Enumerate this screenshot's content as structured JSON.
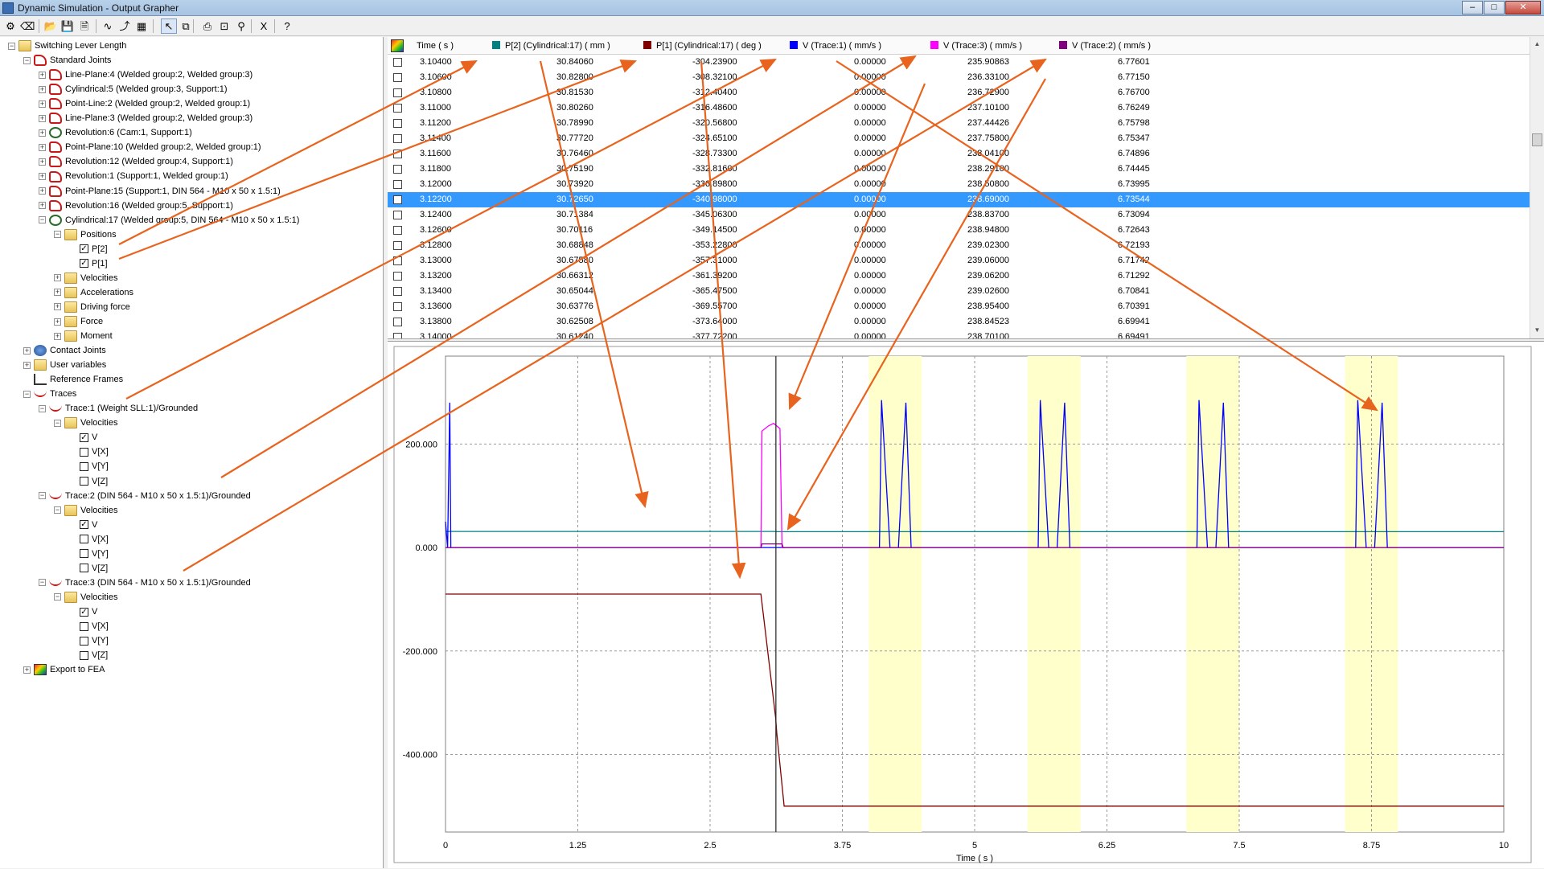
{
  "window": {
    "title": "Dynamic Simulation - Output Grapher",
    "controls": [
      "–",
      "□",
      "✕"
    ]
  },
  "toolbar": {
    "buttons": [
      {
        "icon": "simulate-icon",
        "glyph": "⚙"
      },
      {
        "icon": "eraser-icon",
        "glyph": "⌫"
      },
      {
        "icon": "open-icon",
        "glyph": "📂"
      },
      {
        "icon": "save-icon",
        "glyph": "💾"
      },
      {
        "icon": "save-as-icon",
        "glyph": "🗎"
      },
      {
        "icon": "curve-icon",
        "glyph": "∿"
      },
      {
        "icon": "add-curve-icon",
        "glyph": "⤴"
      },
      {
        "icon": "multi-curve-icon",
        "glyph": "▦"
      },
      {
        "icon": "cursor-icon",
        "glyph": "↖"
      },
      {
        "icon": "copy-icon",
        "glyph": "⧉"
      },
      {
        "icon": "print-icon",
        "glyph": "⎙"
      },
      {
        "icon": "zoom-fit-icon",
        "glyph": "⊡"
      },
      {
        "icon": "zoom-icon",
        "glyph": "⚲"
      },
      {
        "icon": "excel-icon",
        "glyph": "X"
      },
      {
        "icon": "help-icon",
        "glyph": "?"
      }
    ]
  },
  "tree": {
    "nodes": [
      {
        "label": "Switching Lever Length",
        "level": 0,
        "icon": "folder",
        "exp": "−"
      },
      {
        "label": "Standard Joints",
        "level": 1,
        "icon": "joint",
        "exp": "−"
      },
      {
        "label": "Line-Plane:4 (Welded group:2, Welded group:3)",
        "level": 2,
        "icon": "joint",
        "exp": "+"
      },
      {
        "label": "Cylindrical:5 (Welded group:3, Support:1)",
        "level": 2,
        "icon": "joint",
        "exp": "+"
      },
      {
        "label": "Point-Line:2 (Welded group:2, Welded group:1)",
        "level": 2,
        "icon": "joint",
        "exp": "+"
      },
      {
        "label": "Line-Plane:3 (Welded group:2, Welded group:3)",
        "level": 2,
        "icon": "joint",
        "exp": "+"
      },
      {
        "label": "Revolution:6 (Cam:1, Support:1)",
        "level": 2,
        "icon": "rev",
        "exp": "+"
      },
      {
        "label": "Point-Plane:10 (Welded group:2, Welded group:1)",
        "level": 2,
        "icon": "joint",
        "exp": "+"
      },
      {
        "label": "Revolution:12 (Welded group:4, Support:1)",
        "level": 2,
        "icon": "joint",
        "exp": "+"
      },
      {
        "label": "Revolution:1 (Support:1, Welded group:1)",
        "level": 2,
        "icon": "joint",
        "exp": "+"
      },
      {
        "label": "Point-Plane:15 (Support:1, DIN 564 - M10 x 50 x 1.5:1)",
        "level": 2,
        "icon": "joint",
        "exp": "+"
      },
      {
        "label": "Revolution:16 (Welded group:5, Support:1)",
        "level": 2,
        "icon": "joint",
        "exp": "+"
      },
      {
        "label": "Cylindrical:17 (Welded group:5, DIN 564 - M10 x 50 x 1.5:1)",
        "level": 2,
        "icon": "rev",
        "exp": "−"
      },
      {
        "label": "Positions",
        "level": 3,
        "icon": "folder",
        "exp": "−"
      },
      {
        "label": "P[2]",
        "level": 4,
        "icon": "chk",
        "checked": true
      },
      {
        "label": "P[1]",
        "level": 4,
        "icon": "chk",
        "checked": true
      },
      {
        "label": "Velocities",
        "level": 3,
        "icon": "folder",
        "exp": "+"
      },
      {
        "label": "Accelerations",
        "level": 3,
        "icon": "folder",
        "exp": "+"
      },
      {
        "label": "Driving force",
        "level": 3,
        "icon": "folder",
        "exp": "+"
      },
      {
        "label": "Force",
        "level": 3,
        "icon": "folder",
        "exp": "+"
      },
      {
        "label": "Moment",
        "level": 3,
        "icon": "folder",
        "exp": "+"
      },
      {
        "label": "Contact Joints",
        "level": 1,
        "icon": "contact",
        "exp": "+"
      },
      {
        "label": "User variables",
        "level": 1,
        "icon": "folder",
        "exp": "+"
      },
      {
        "label": "Reference Frames",
        "level": 1,
        "icon": "ref",
        "exp": ""
      },
      {
        "label": "Traces",
        "level": 1,
        "icon": "trace",
        "exp": "−"
      },
      {
        "label": "Trace:1 (Weight SLL:1)/Grounded",
        "level": 2,
        "icon": "trace",
        "exp": "−"
      },
      {
        "label": "Velocities",
        "level": 3,
        "icon": "folder",
        "exp": "−"
      },
      {
        "label": "V",
        "level": 4,
        "icon": "chk",
        "checked": true
      },
      {
        "label": "V[X]",
        "level": 4,
        "icon": "chk",
        "checked": false
      },
      {
        "label": "V[Y]",
        "level": 4,
        "icon": "chk",
        "checked": false
      },
      {
        "label": "V[Z]",
        "level": 4,
        "icon": "chk",
        "checked": false
      },
      {
        "label": "Trace:2 (DIN 564 - M10 x 50 x 1.5:1)/Grounded",
        "level": 2,
        "icon": "trace",
        "exp": "−"
      },
      {
        "label": "Velocities",
        "level": 3,
        "icon": "folder",
        "exp": "−"
      },
      {
        "label": "V",
        "level": 4,
        "icon": "chk",
        "checked": true
      },
      {
        "label": "V[X]",
        "level": 4,
        "icon": "chk",
        "checked": false
      },
      {
        "label": "V[Y]",
        "level": 4,
        "icon": "chk",
        "checked": false
      },
      {
        "label": "V[Z]",
        "level": 4,
        "icon": "chk",
        "checked": false
      },
      {
        "label": "Trace:3 (DIN 564 - M10 x 50 x 1.5:1)/Grounded",
        "level": 2,
        "icon": "trace",
        "exp": "−"
      },
      {
        "label": "Velocities",
        "level": 3,
        "icon": "folder",
        "exp": "−"
      },
      {
        "label": "V",
        "level": 4,
        "icon": "chk",
        "checked": true
      },
      {
        "label": "V[X]",
        "level": 4,
        "icon": "chk",
        "checked": false
      },
      {
        "label": "V[Y]",
        "level": 4,
        "icon": "chk",
        "checked": false
      },
      {
        "label": "V[Z]",
        "level": 4,
        "icon": "chk",
        "checked": false
      },
      {
        "label": "Export to FEA",
        "level": 1,
        "icon": "fea",
        "exp": "+"
      }
    ]
  },
  "grid": {
    "columns": [
      {
        "label": "Time ( s )",
        "color": ""
      },
      {
        "label": "P[2] (Cylindrical:17) ( mm )",
        "color": "#008080"
      },
      {
        "label": "P[1] (Cylindrical:17) ( deg )",
        "color": "#800000"
      },
      {
        "label": "V (Trace:1) ( mm/s )",
        "color": "#0000ff"
      },
      {
        "label": "V (Trace:3) ( mm/s )",
        "color": "#ff00ff"
      },
      {
        "label": "V (Trace:2) ( mm/s )",
        "color": "#800080"
      }
    ],
    "selected_row": 9,
    "rows": [
      [
        "3.10400",
        "30.84060",
        "-304.23900",
        "0.00000",
        "235.90863",
        "6.77601"
      ],
      [
        "3.10600",
        "30.82800",
        "-308.32100",
        "0.00000",
        "236.33100",
        "6.77150"
      ],
      [
        "3.10800",
        "30.81530",
        "-312.40400",
        "0.00000",
        "236.72900",
        "6.76700"
      ],
      [
        "3.11000",
        "30.80260",
        "-316.48600",
        "0.00000",
        "237.10100",
        "6.76249"
      ],
      [
        "3.11200",
        "30.78990",
        "-320.56800",
        "0.00000",
        "237.44426",
        "6.75798"
      ],
      [
        "3.11400",
        "30.77720",
        "-324.65100",
        "0.00000",
        "237.75800",
        "6.75347"
      ],
      [
        "3.11600",
        "30.76460",
        "-328.73300",
        "0.00000",
        "238.04100",
        "6.74896"
      ],
      [
        "3.11800",
        "30.75190",
        "-332.81600",
        "0.00000",
        "238.29100",
        "6.74445"
      ],
      [
        "3.12000",
        "30.73920",
        "-336.89800",
        "0.00000",
        "238.50800",
        "6.73995"
      ],
      [
        "3.12200",
        "30.72650",
        "-340.98000",
        "0.00000",
        "238.69000",
        "6.73544"
      ],
      [
        "3.12400",
        "30.71384",
        "-345.06300",
        "0.00000",
        "238.83700",
        "6.73094"
      ],
      [
        "3.12600",
        "30.70116",
        "-349.14500",
        "0.00000",
        "238.94800",
        "6.72643"
      ],
      [
        "3.12800",
        "30.68848",
        "-353.22800",
        "0.00000",
        "239.02300",
        "6.72193"
      ],
      [
        "3.13000",
        "30.67580",
        "-357.31000",
        "0.00000",
        "239.06000",
        "6.71742"
      ],
      [
        "3.13200",
        "30.66312",
        "-361.39200",
        "0.00000",
        "239.06200",
        "6.71292"
      ],
      [
        "3.13400",
        "30.65044",
        "-365.47500",
        "0.00000",
        "239.02600",
        "6.70841"
      ],
      [
        "3.13600",
        "30.63776",
        "-369.55700",
        "0.00000",
        "238.95400",
        "6.70391"
      ],
      [
        "3.13800",
        "30.62508",
        "-373.64000",
        "0.00000",
        "238.84523",
        "6.69941"
      ],
      [
        "3.14000",
        "30.61240",
        "-377.72200",
        "0.00000",
        "238.70100",
        "6.69491"
      ]
    ]
  },
  "chart_data": {
    "type": "line",
    "xlabel": "Time ( s )",
    "xlim": [
      0,
      10
    ],
    "ylim": [
      -550,
      370
    ],
    "xticks": [
      0,
      1.25,
      2.5,
      3.75,
      5,
      6.25,
      7.5,
      8.75,
      10
    ],
    "xtick_labels": [
      "0",
      "1.25",
      "2.5",
      "3.75",
      "5",
      "6.25",
      "7.5",
      "8.75",
      "10"
    ],
    "yticks": [
      200,
      0,
      -200,
      -400
    ],
    "ytick_labels": [
      "200.000",
      "0.000",
      "-200.000",
      "-400.000"
    ],
    "grid": true,
    "cursor_x": 3.122,
    "highlight_bands": [
      [
        4.0,
        4.5
      ],
      [
        5.5,
        6.0
      ],
      [
        7.0,
        7.5
      ],
      [
        8.5,
        9.0
      ]
    ],
    "series": [
      {
        "name": "P[2] (Cylindrical:17) ( mm )",
        "color": "#008080",
        "points": [
          [
            0,
            31.0
          ],
          [
            3.1,
            31.0
          ],
          [
            3.14,
            30.6
          ],
          [
            10,
            30.6
          ]
        ]
      },
      {
        "name": "P[1] (Cylindrical:17) ( deg )",
        "color": "#800000",
        "points": [
          [
            0,
            -90
          ],
          [
            2.98,
            -90
          ],
          [
            3.12,
            -330
          ],
          [
            3.13,
            -358
          ],
          [
            3.2,
            -500
          ],
          [
            10,
            -500
          ]
        ]
      },
      {
        "name": "V (Trace:1) ( mm/s )",
        "color": "#0000ff",
        "points": [
          [
            0,
            50
          ],
          [
            0.02,
            0
          ],
          [
            0.04,
            280
          ],
          [
            0.05,
            0
          ],
          [
            3.12,
            0
          ],
          [
            4.1,
            0
          ],
          [
            4.12,
            285
          ],
          [
            4.2,
            0
          ],
          [
            4.28,
            0
          ],
          [
            4.35,
            280
          ],
          [
            4.4,
            0
          ],
          [
            5.6,
            0
          ],
          [
            5.62,
            285
          ],
          [
            5.7,
            0
          ],
          [
            5.78,
            0
          ],
          [
            5.85,
            280
          ],
          [
            5.9,
            0
          ],
          [
            7.1,
            0
          ],
          [
            7.12,
            285
          ],
          [
            7.2,
            0
          ],
          [
            7.28,
            0
          ],
          [
            7.35,
            280
          ],
          [
            7.4,
            0
          ],
          [
            8.6,
            0
          ],
          [
            8.62,
            285
          ],
          [
            8.7,
            0
          ],
          [
            8.78,
            0
          ],
          [
            8.85,
            280
          ],
          [
            8.9,
            0
          ],
          [
            10,
            0
          ]
        ]
      },
      {
        "name": "V (Trace:3) ( mm/s )",
        "color": "#ff00ff",
        "points": [
          [
            0,
            0
          ],
          [
            2.98,
            0
          ],
          [
            2.99,
            225
          ],
          [
            3.05,
            235
          ],
          [
            3.1,
            240
          ],
          [
            3.16,
            230
          ],
          [
            3.18,
            0
          ],
          [
            10,
            0
          ]
        ]
      },
      {
        "name": "V (Trace:2) ( mm/s )",
        "color": "#800080",
        "points": [
          [
            0,
            0
          ],
          [
            2.98,
            0
          ],
          [
            2.99,
            7
          ],
          [
            3.18,
            7
          ],
          [
            3.19,
            0
          ],
          [
            10,
            0
          ]
        ]
      }
    ]
  }
}
